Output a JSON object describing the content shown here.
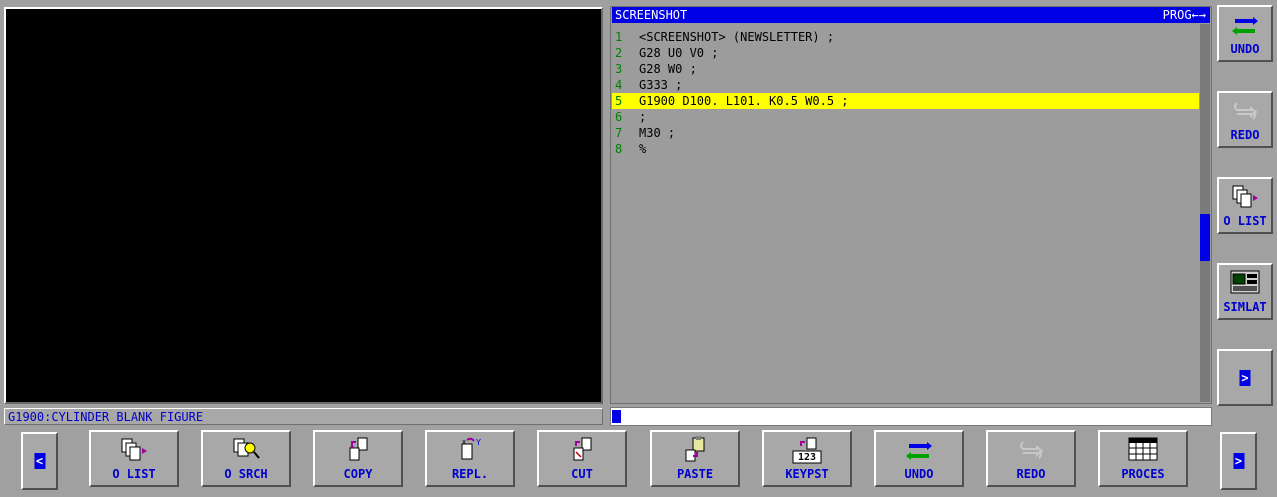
{
  "graphic": {
    "status": "G1900:CYLINDER BLANK FIGURE"
  },
  "editor": {
    "title": "SCREENSHOT",
    "mode": "PROG←→",
    "lines": [
      {
        "num": "1",
        "code": "<SCREENSHOT> (NEWSLETTER) ;"
      },
      {
        "num": "2",
        "code": "G28 U0 V0 ;"
      },
      {
        "num": "3",
        "code": "G28 W0 ;"
      },
      {
        "num": "4",
        "code": "G333 ;"
      },
      {
        "num": "5",
        "code": "G1900 D100. L101. K0.5 W0.5 ;"
      },
      {
        "num": "6",
        "code": ";"
      },
      {
        "num": "7",
        "code": "M30 ;"
      },
      {
        "num": "8",
        "code": "%"
      }
    ],
    "active_line": 5
  },
  "right_keys": {
    "undo": "UNDO",
    "redo": "REDO",
    "o_list": "O LIST",
    "simlat": "SIMLAT",
    "next": ">"
  },
  "bottom_keys": {
    "prev": "<",
    "o_list": "O LIST",
    "o_srch": "O SRCH",
    "copy": "COPY",
    "repl": "REPL.",
    "cut": "CUT",
    "paste": "PASTE",
    "keypst": "KEYPST",
    "keypst_icon_text": "123",
    "undo": "UNDO",
    "redo": "REDO",
    "proces": "PROCES",
    "next": ">"
  },
  "colors": {
    "title_bar": "#0000e6",
    "highlight": "#ffff00",
    "line_numbers": "#008000",
    "key_text": "#0000d0"
  }
}
